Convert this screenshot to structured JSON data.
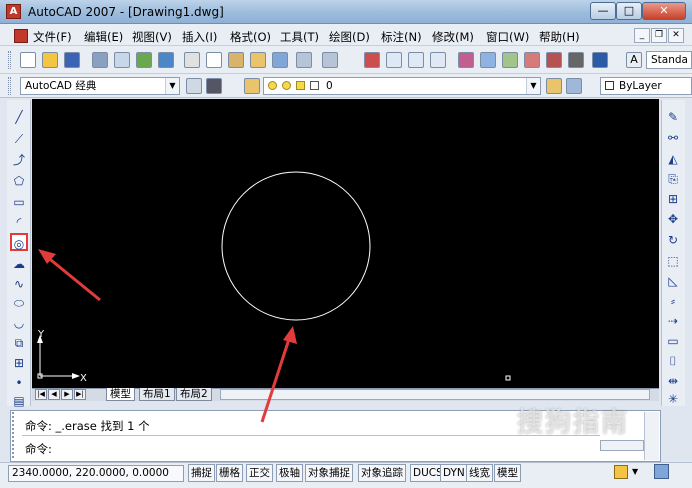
{
  "window": {
    "title": "AutoCAD 2007 - [Drawing1.dwg]",
    "app_icon_glyph": "A",
    "controls": {
      "minimize": "—",
      "maximize": "□",
      "close": "✕"
    }
  },
  "menubar": {
    "items": [
      {
        "label": "文件(F)"
      },
      {
        "label": "编辑(E)"
      },
      {
        "label": "视图(V)"
      },
      {
        "label": "插入(I)"
      },
      {
        "label": "格式(O)"
      },
      {
        "label": "工具(T)"
      },
      {
        "label": "绘图(D)"
      },
      {
        "label": "标注(N)"
      },
      {
        "label": "修改(M)"
      },
      {
        "label": "窗口(W)"
      },
      {
        "label": "帮助(H)"
      }
    ],
    "mdi_controls": {
      "minimize": "_",
      "restore": "❐",
      "close": "✕"
    }
  },
  "toolbar": {
    "text_style_combo": "Standa"
  },
  "workspace": {
    "combo": "AutoCAD 经典"
  },
  "layer": {
    "combo": "0"
  },
  "properties": {
    "color_combo": "ByLayer"
  },
  "layout_tabs": {
    "model": "模型",
    "layout1": "布局1",
    "layout2": "布局2"
  },
  "ucs": {
    "x_label": "X",
    "y_label": "Y"
  },
  "command": {
    "history": "命令: _.erase 找到 1 个",
    "prompt": "命令:"
  },
  "status": {
    "coordinates": "2340.0000, 220.0000, 0.0000",
    "buttons": [
      "捕捉",
      "栅格",
      "正交",
      "极轴",
      "对象捕捉",
      "对象追踪",
      "DUCS",
      "DYN",
      "线宽",
      "模型"
    ]
  },
  "colors": {
    "canvas": "#000000",
    "circle": "#ffffff",
    "highlight": "#e23b3b",
    "annotation_arrow": "#e23b3b"
  },
  "watermark": "搜狗指南"
}
